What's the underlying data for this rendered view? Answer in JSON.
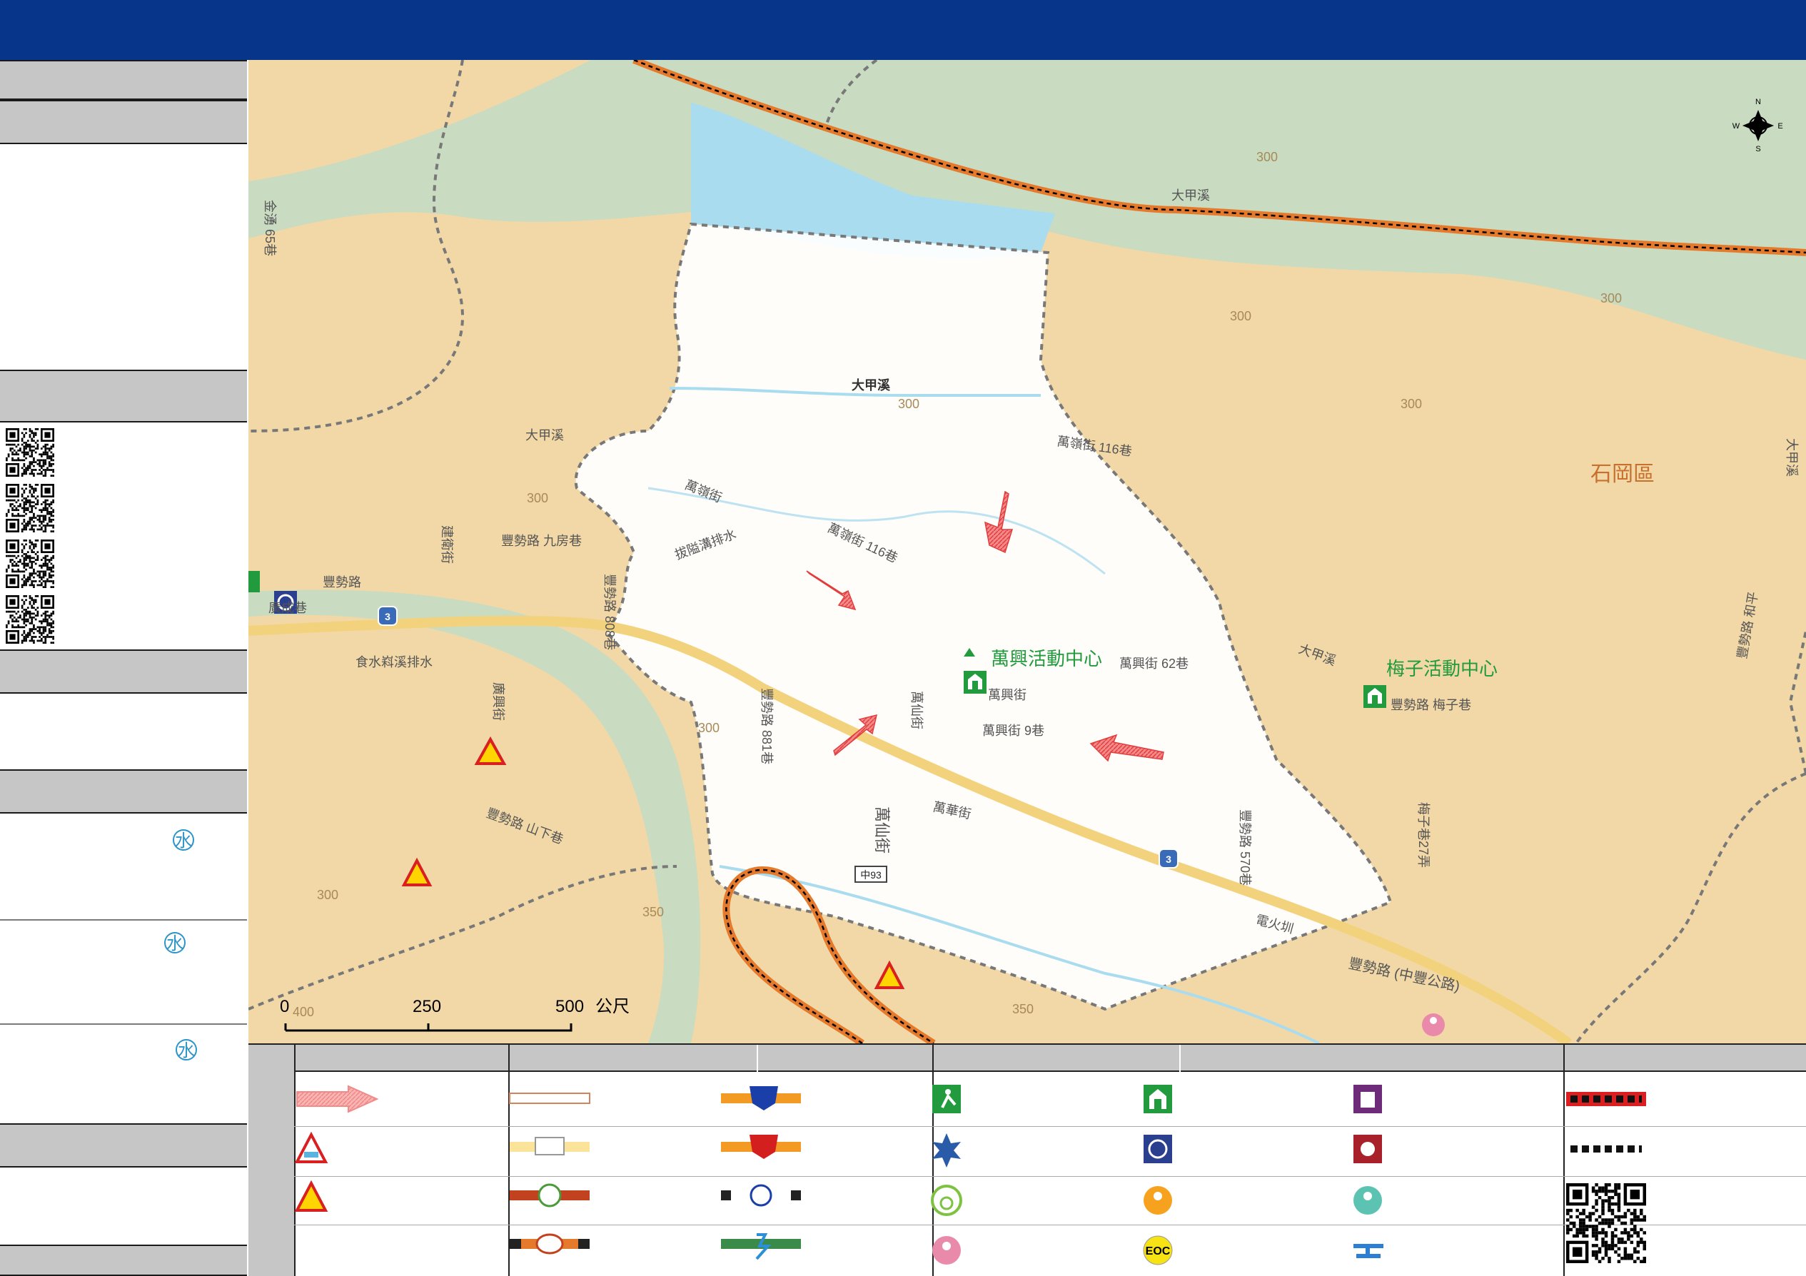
{
  "map": {
    "labels": {
      "river_main": "大甲溪",
      "river_west": "大甲溪",
      "river_small": "大甲溪",
      "river_east_lower": "大甲溪",
      "river_east_vertical": "大甲溪",
      "district": "石岡區",
      "center_wanxing": "萬興活動中心",
      "center_meizi": "梅子活動中心",
      "contour_300": "300",
      "contour_350": "350",
      "contour_400": "400",
      "road_fengshi": "豐勢路",
      "road_fengshi_main": "豐勢路 (中豐公路)",
      "road_fengshi_jiufang": "豐勢路 九房巷",
      "road_fengshi_808": "豐勢路 808巷",
      "road_fengshi_881": "豐勢路 881巷",
      "road_fengshi_570": "豐勢路 570巷",
      "road_fengshi_meizi": "豐勢路 梅子巷",
      "road_fengshi_xiashan": "豐勢路 山下巷",
      "road_meizi27": "梅子巷27弄",
      "road_fengshi_meizi27": "豐勢路",
      "road_jiuyuan": "九房巷",
      "road_wanling": "萬嶺街",
      "road_wanling116a": "萬嶺街 116巷",
      "road_wanling116b": "萬嶺街 116巷",
      "road_wanxing": "萬興街",
      "road_wanxing9": "萬興街 9巷",
      "road_wanxing62": "萬興街 62巷",
      "road_wanhua": "萬華街",
      "road_wanxian": "萬仙街",
      "road_wanxian_x": "萬仙街",
      "road_jianwei": "建衛街",
      "road_jinyong": "金湧 65巷",
      "road_guangxing": "廣興街",
      "road_guangcheng": "廣成巷",
      "road_ditch1": "食水嵙溪排水",
      "road_ditch2": "拔隘溝排水",
      "road_ditch3": "電火圳",
      "road_heping": "豐勢路 和平",
      "road_zhong93": "中93",
      "road_3": "3"
    },
    "compass": {
      "n": "N",
      "s": "S",
      "e": "E",
      "w": "W"
    },
    "scale": {
      "s0": "0",
      "s250": "250",
      "s500": "500",
      "unit": "公尺"
    }
  },
  "sidebar": {
    "water_mark": "水"
  },
  "legend": {
    "eoc_text": "EOC"
  },
  "colors": {
    "header": "#07358a",
    "land": "#f2d8a6",
    "river": "#c9dbc1",
    "lake": "#a9dcef",
    "evac_zone": "#ffffff",
    "road_main": "#f3d27e",
    "railway": "#e5792c",
    "boundary": "#787878",
    "arrow": "#e94b4b",
    "center": "#229a3e"
  }
}
